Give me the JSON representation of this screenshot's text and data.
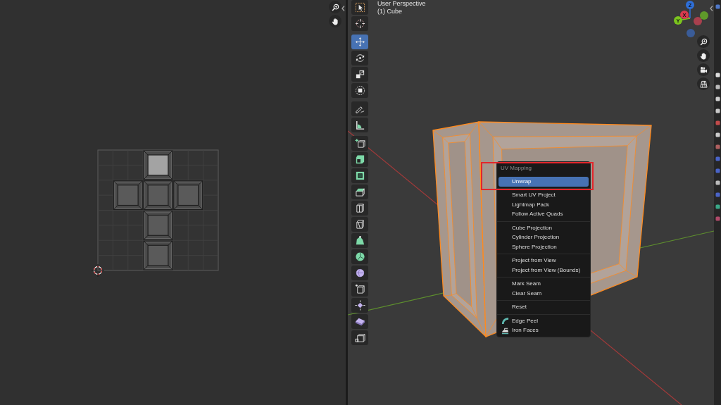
{
  "uv_editor": {
    "faces": [
      {
        "selected": true
      },
      {
        "selected": false
      },
      {
        "selected": false
      },
      {
        "selected": false
      },
      {
        "selected": false
      },
      {
        "selected": false
      }
    ]
  },
  "viewport": {
    "view_name": "User Perspective",
    "object_label": "(1) Cube",
    "toolbar": [
      {
        "tools": [
          {
            "kind": "select",
            "selected": false
          },
          {
            "kind": "cursor",
            "selected": false
          }
        ]
      },
      {
        "tools": [
          {
            "kind": "move",
            "selected": true
          },
          {
            "kind": "rotate",
            "selected": false
          },
          {
            "kind": "scale",
            "selected": false
          },
          {
            "kind": "transform",
            "selected": false
          }
        ]
      },
      {
        "tools": [
          {
            "kind": "annotate",
            "selected": false
          },
          {
            "kind": "measure",
            "selected": false
          }
        ]
      },
      {
        "tools": [
          {
            "kind": "add_cube",
            "selected": false
          },
          {
            "kind": "extrude",
            "selected": false
          },
          {
            "kind": "inset",
            "selected": false
          },
          {
            "kind": "bevel",
            "selected": false
          },
          {
            "kind": "loop_cut",
            "selected": false
          },
          {
            "kind": "knife",
            "selected": false
          },
          {
            "kind": "poly_build",
            "selected": false
          },
          {
            "kind": "spin",
            "selected": false
          },
          {
            "kind": "smooth",
            "selected": false
          },
          {
            "kind": "edge_slide",
            "selected": false
          },
          {
            "kind": "shrink_fatten",
            "selected": false
          },
          {
            "kind": "shear",
            "selected": false
          },
          {
            "kind": "rip",
            "selected": false
          }
        ]
      }
    ],
    "gizmo": {
      "axes": [
        {
          "label": "Z",
          "color": "#2e6fd8"
        },
        {
          "label": "X",
          "color": "#d9394e"
        },
        {
          "label": "Y",
          "color": "#7bc41e"
        },
        {
          "color": "#a8404e"
        },
        {
          "color": "#5f9a2a"
        },
        {
          "color": "#3a5c98"
        }
      ]
    },
    "menu": {
      "title": "UV Mapping",
      "highlight_frame": true,
      "groups": [
        {
          "items": [
            {
              "label": "Unwrap",
              "kind": "plain",
              "selected": true
            }
          ]
        },
        {
          "items": [
            {
              "label": "Smart UV Project",
              "kind": "plain",
              "selected": false
            },
            {
              "label": "Lightmap Pack",
              "kind": "plain",
              "selected": false
            },
            {
              "label": "Follow Active Quads",
              "kind": "plain",
              "selected": false
            }
          ]
        },
        {
          "items": [
            {
              "label": "Cube Projection",
              "kind": "plain",
              "selected": false
            },
            {
              "label": "Cylinder Projection",
              "kind": "plain",
              "selected": false
            },
            {
              "label": "Sphere Projection",
              "kind": "plain",
              "selected": false
            }
          ]
        },
        {
          "items": [
            {
              "label": "Project from View",
              "kind": "plain",
              "selected": false
            },
            {
              "label": "Project from View (Bounds)",
              "kind": "plain",
              "selected": false
            }
          ]
        },
        {
          "items": [
            {
              "label": "Mark Seam",
              "kind": "plain",
              "selected": false
            },
            {
              "label": "Clear Seam",
              "kind": "plain",
              "selected": false
            }
          ]
        },
        {
          "items": [
            {
              "label": "Reset",
              "kind": "plain",
              "selected": false
            }
          ]
        },
        {
          "items": [
            {
              "label": "Edge Peel",
              "kind": "peel",
              "selected": false
            },
            {
              "label": "Iron Faces",
              "kind": "iron",
              "selected": false
            }
          ]
        }
      ]
    }
  }
}
